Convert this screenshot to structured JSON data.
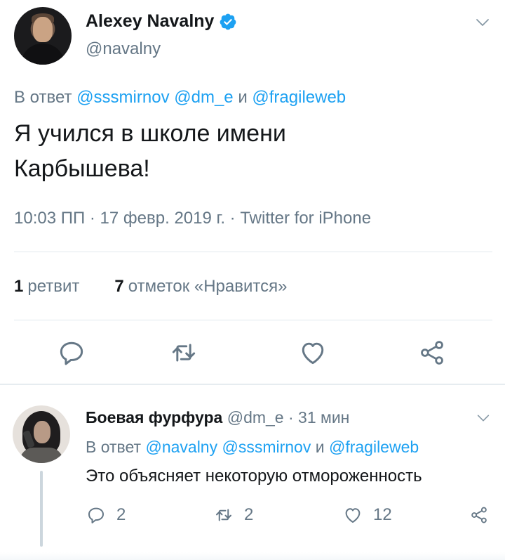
{
  "main_tweet": {
    "author_name": "Alexey Navalny",
    "handle": "@navalny",
    "reply_prefix": "В ответ",
    "reply_mention_1": "@sssmirnov",
    "reply_mention_2": "@dm_e",
    "reply_joiner": "и",
    "reply_mention_3": "@fragileweb",
    "text_line_1": "Я учился в школе имени",
    "text_line_2": "Карбышева!",
    "meta": "10:03 ПП · 17 февр. 2019 г. · Twitter for iPhone",
    "retweets_count": "1",
    "retweets_label": "ретвит",
    "likes_count": "7",
    "likes_label": "отметок «Нравится»"
  },
  "reply_tweet": {
    "author_name": "Боевая фурфура",
    "handle_time": "@dm_e · 31 мин",
    "reply_prefix": "В ответ",
    "reply_mention_1": "@navalny",
    "reply_mention_2": "@sssmirnov",
    "reply_joiner": "и",
    "reply_mention_3": "@fragileweb",
    "text": "Это объясняет некоторую отмороженность",
    "replies_count": "2",
    "retweets_count": "2",
    "likes_count": "12"
  },
  "colors": {
    "accent": "#1da1f2",
    "secondary_text": "#657786",
    "primary_text": "#14171a",
    "divider": "#e1e8ed"
  },
  "icons": [
    "verified-badge-icon",
    "chevron-down-icon",
    "reply-icon",
    "retweet-icon",
    "like-icon",
    "share-icon"
  ]
}
